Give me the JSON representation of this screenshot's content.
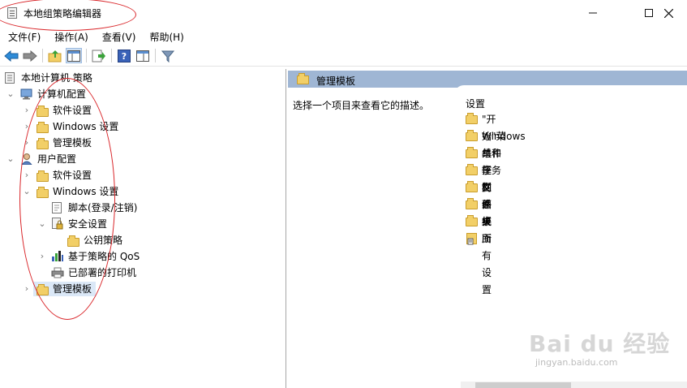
{
  "window": {
    "title": "本地组策略编辑器",
    "minimize_icon": "minimize-icon",
    "maximize_icon": "maximize-icon",
    "close_icon": "close-icon"
  },
  "menu": [
    {
      "label": "文件(F)"
    },
    {
      "label": "操作(A)"
    },
    {
      "label": "查看(V)"
    },
    {
      "label": "帮助(H)"
    }
  ],
  "toolbar": {
    "buttons": [
      "back-arrow-icon",
      "forward-arrow-icon",
      "up-folder-icon",
      "show-hide-tree-icon",
      "export-list-icon",
      "help-icon",
      "properties-icon",
      "filter-icon"
    ]
  },
  "tree": {
    "root": "本地计算机 策略",
    "items": [
      {
        "label": "计算机配置"
      },
      {
        "label": "软件设置"
      },
      {
        "label": "Windows 设置"
      },
      {
        "label": "管理模板"
      },
      {
        "label": "用户配置"
      },
      {
        "label": "软件设置"
      },
      {
        "label": "Windows 设置"
      },
      {
        "label": "脚本(登录/注销)"
      },
      {
        "label": "安全设置"
      },
      {
        "label": "公钥策略"
      },
      {
        "label": "基于策略的 QoS"
      },
      {
        "label": "已部署的打印机"
      },
      {
        "label": "管理模板"
      }
    ]
  },
  "right": {
    "header": "管理模板",
    "description": "选择一个项目来查看它的描述。",
    "settings_header": "设置",
    "settings": [
      {
        "label": "\"开始\"菜单和任务栏"
      },
      {
        "label": "Windows 组件"
      },
      {
        "label": "共享文件夹"
      },
      {
        "label": "控制面板"
      },
      {
        "label": "网络"
      },
      {
        "label": "系统"
      },
      {
        "label": "桌面"
      },
      {
        "label": "所有设置"
      }
    ]
  },
  "watermark": {
    "main": "Bai du 经验",
    "sub": "jingyan.baidu.com"
  },
  "colors": {
    "header_bg": "#9fb6d4",
    "selection_bg": "#dbe8f7",
    "folder": "#f2cf67",
    "annotation": "#d9262a"
  }
}
